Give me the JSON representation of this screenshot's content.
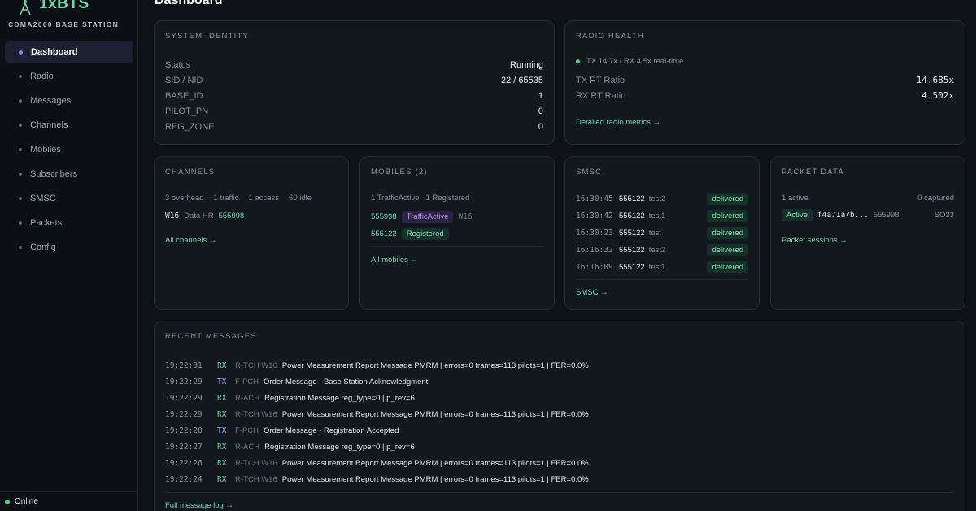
{
  "brand": {
    "name": "1xBTS",
    "subtitle": "CDMA2000 BASE STATION"
  },
  "page_title": "Dashboard",
  "nav": [
    {
      "label": "Dashboard",
      "active": true
    },
    {
      "label": "Radio"
    },
    {
      "label": "Messages"
    },
    {
      "label": "Channels"
    },
    {
      "label": "Mobiles"
    },
    {
      "label": "Subscribers"
    },
    {
      "label": "SMSC"
    },
    {
      "label": "Packets"
    },
    {
      "label": "Config"
    }
  ],
  "footer_status": "Online",
  "system_identity": {
    "title": "SYSTEM IDENTITY",
    "rows": [
      {
        "k": "Status",
        "v": "Running"
      },
      {
        "k": "SID / NID",
        "v": "22 / 65535"
      },
      {
        "k": "BASE_ID",
        "v": "1"
      },
      {
        "k": "PILOT_PN",
        "v": "0"
      },
      {
        "k": "REG_ZONE",
        "v": "0"
      }
    ]
  },
  "radio_health": {
    "title": "RADIO HEALTH",
    "summary": "TX 14.7x / RX 4.5x real-time",
    "rows": [
      {
        "k": "TX RT Ratio",
        "v": "14.685x"
      },
      {
        "k": "RX RT Ratio",
        "v": "4.502x"
      }
    ],
    "link": "Detailed radio metrics →"
  },
  "channels": {
    "title": "CHANNELS",
    "stats": [
      "3 overhead",
      "1 traffic",
      "1 access",
      "60 idle"
    ],
    "entry": {
      "id": "W16",
      "type": "Data HR",
      "imsi": "555998"
    },
    "link": "All channels →"
  },
  "mobiles": {
    "title": "MOBILES (2)",
    "stats": [
      "1 TrafficActive",
      "1 Registered"
    ],
    "rows": [
      {
        "id": "555998",
        "state": "TrafficActive",
        "ch": "W16"
      },
      {
        "id": "555122",
        "state": "Registered",
        "ch": ""
      }
    ],
    "link": "All mobiles →"
  },
  "smsc": {
    "title": "SMSC",
    "rows": [
      {
        "time": "16:30:45",
        "num": "555122",
        "text": "test2",
        "status": "delivered"
      },
      {
        "time": "16:30:42",
        "num": "555122",
        "text": "test1",
        "status": "delivered"
      },
      {
        "time": "16:30:23",
        "num": "555122",
        "text": "test",
        "status": "delivered"
      },
      {
        "time": "16:16:32",
        "num": "555122",
        "text": "test2",
        "status": "delivered"
      },
      {
        "time": "16:16:09",
        "num": "555122",
        "text": "test1",
        "status": "delivered"
      }
    ],
    "link": "SMSC →"
  },
  "packet_data": {
    "title": "PACKET DATA",
    "active": "1 active",
    "captured": "0 captured",
    "session": {
      "state": "Active",
      "id": "f4a71a7b...",
      "imsi": "555998",
      "so": "SO33"
    },
    "link": "Packet sessions →"
  },
  "recent_messages": {
    "title": "RECENT MESSAGES",
    "rows": [
      {
        "time": "19:22:31",
        "dir": "RX",
        "ch": "R-TCH W16",
        "text": "Power Measurement Report Message PMRM | errors=0 frames=113 pilots=1 | FER=0.0%"
      },
      {
        "time": "19:22:29",
        "dir": "TX",
        "ch": "F-PCH",
        "text": "Order Message - Base Station Acknowledgment"
      },
      {
        "time": "19:22:29",
        "dir": "RX",
        "ch": "R-ACH",
        "text": "Registration Message reg_type=0 | p_rev=6"
      },
      {
        "time": "19:22:29",
        "dir": "RX",
        "ch": "R-TCH W16",
        "text": "Power Measurement Report Message PMRM | errors=0 frames=113 pilots=1 | FER=0.0%"
      },
      {
        "time": "19:22:28",
        "dir": "TX",
        "ch": "F-PCH",
        "text": "Order Message - Registration Accepted"
      },
      {
        "time": "19:22:27",
        "dir": "RX",
        "ch": "R-ACH",
        "text": "Registration Message reg_type=0 | p_rev=6"
      },
      {
        "time": "19:22:26",
        "dir": "RX",
        "ch": "R-TCH W16",
        "text": "Power Measurement Report Message PMRM | errors=0 frames=113 pilots=1 | FER=0.0%"
      },
      {
        "time": "19:22:24",
        "dir": "RX",
        "ch": "R-TCH W16",
        "text": "Power Measurement Report Message PMRM | errors=0 frames=113 pilots=1 | FER=0.0%"
      }
    ],
    "link": "Full message log →"
  },
  "icons": {
    "brand": "antenna-icon",
    "nav": "dot-icon",
    "status": "status-dot-icon"
  },
  "colors": {
    "accent_green": "#6fd3a8",
    "accent_blue": "#6b8cff",
    "background": "#0e1117"
  }
}
